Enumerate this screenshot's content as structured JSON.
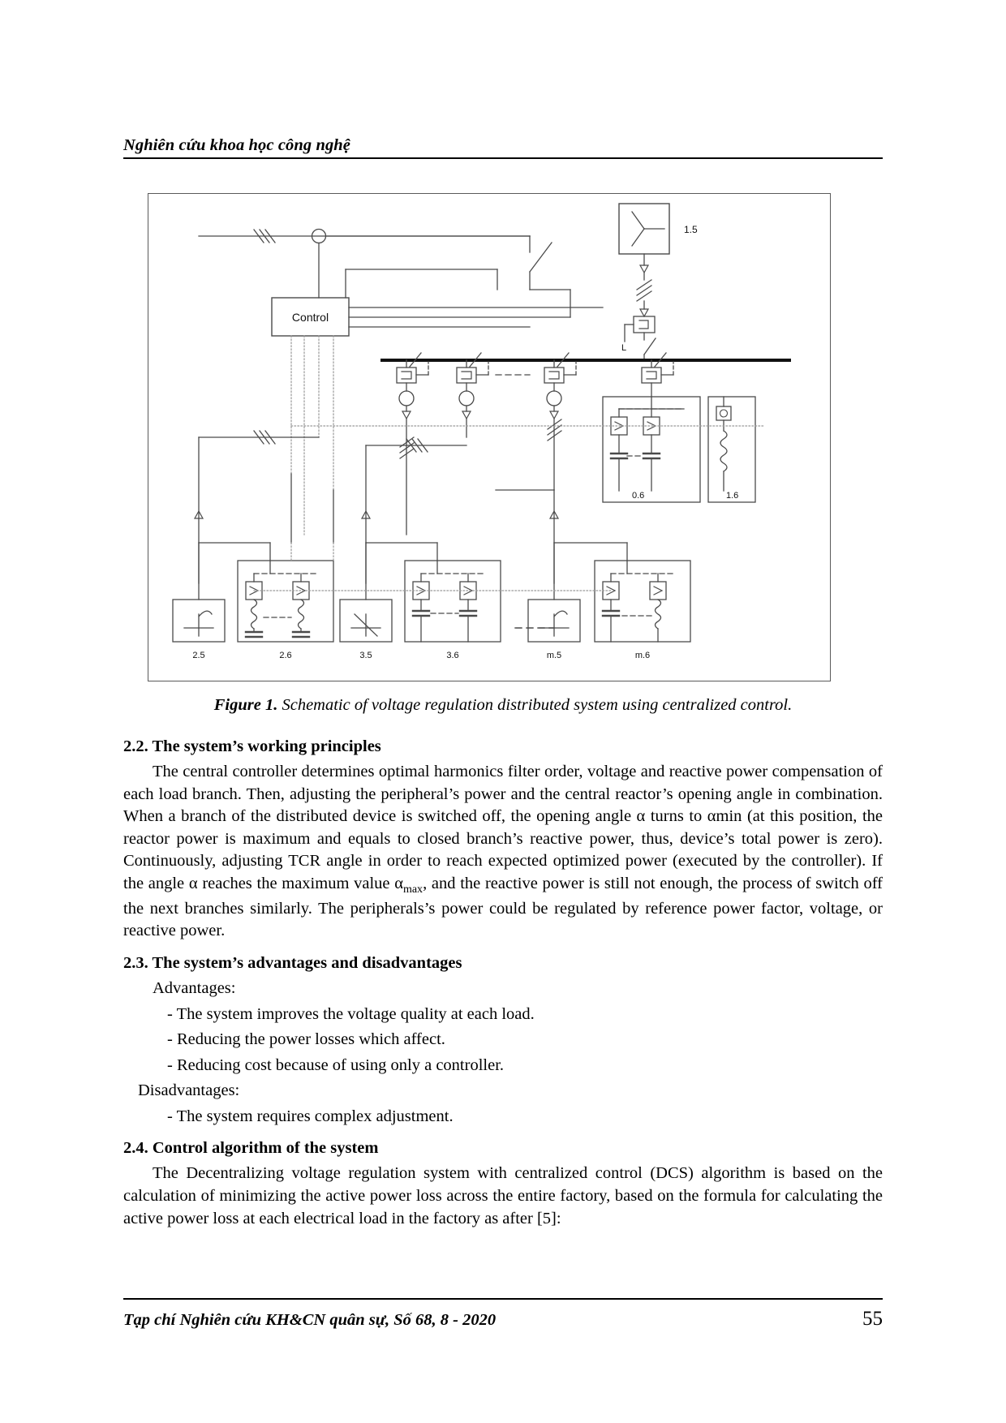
{
  "header": {
    "running_title": "Nghiên cứu khoa học công nghệ"
  },
  "figure": {
    "caption_label": "Figure 1.",
    "caption_text": " Schematic of voltage regulation distributed system using centralized control.",
    "control_box_label": "Control",
    "reactor_label": "L",
    "labels": {
      "central_source": "1.5",
      "central_filter_a": "0.6",
      "central_filter_b": "1.6",
      "branch2_load": "2.5",
      "branch2_filter": "2.6",
      "branch3_load": "3.5",
      "branch3_filter": "3.6",
      "branchm_load": "m.5",
      "branchm_filter": "m.6"
    }
  },
  "sections": {
    "s22_heading": "2.2. The system’s working principles",
    "s22_para": "The central controller determines optimal harmonics filter order, voltage and reactive power compensation of each load branch. Then, adjusting the peripheral’s power and the central reactor’s opening angle in combination. When a branch of the distributed device is switched off, the opening angle α turns to αmin (at this position, the reactor power is maximum and equals to closed branch’s reactive power, thus, device’s total power is zero). Continuously, adjusting TCR angle in order to reach expected optimized power (executed by the controller). If the angle α reaches the maximum value α",
    "s22_para_sub": "max",
    "s22_para_tail": ", and the reactive power is still not enough, the process of switch off the next branches similarly. The peripherals’s power could be regulated by reference power factor, voltage, or reactive power.",
    "s23_heading": "2.3. The system’s advantages and disadvantages",
    "advantages_label": "Advantages:",
    "advantages": [
      "- The system improves the voltage quality at each load.",
      "- Reducing the power losses which affect.",
      "- Reducing cost because of using only a controller."
    ],
    "disadvantages_label": "Disadvantages:",
    "disadvantages": [
      "- The system requires complex adjustment."
    ],
    "s24_heading": "2.4. Control algorithm of the system",
    "s24_para": "The Decentralizing voltage regulation system with centralized control (DCS) algorithm is based on the calculation of minimizing the active power loss across the entire factory, based on the formula for calculating the active power loss at each electrical load in the factory as after [5]:"
  },
  "footer": {
    "journal_line": "Tạp chí Nghiên cứu KH&CN quân sự, Số 68, 8 - 2020",
    "page_number": "55"
  },
  "colors": {
    "ink": "#000000",
    "diagram_line": "#4a4a4a",
    "border": "#5a5a5a"
  }
}
